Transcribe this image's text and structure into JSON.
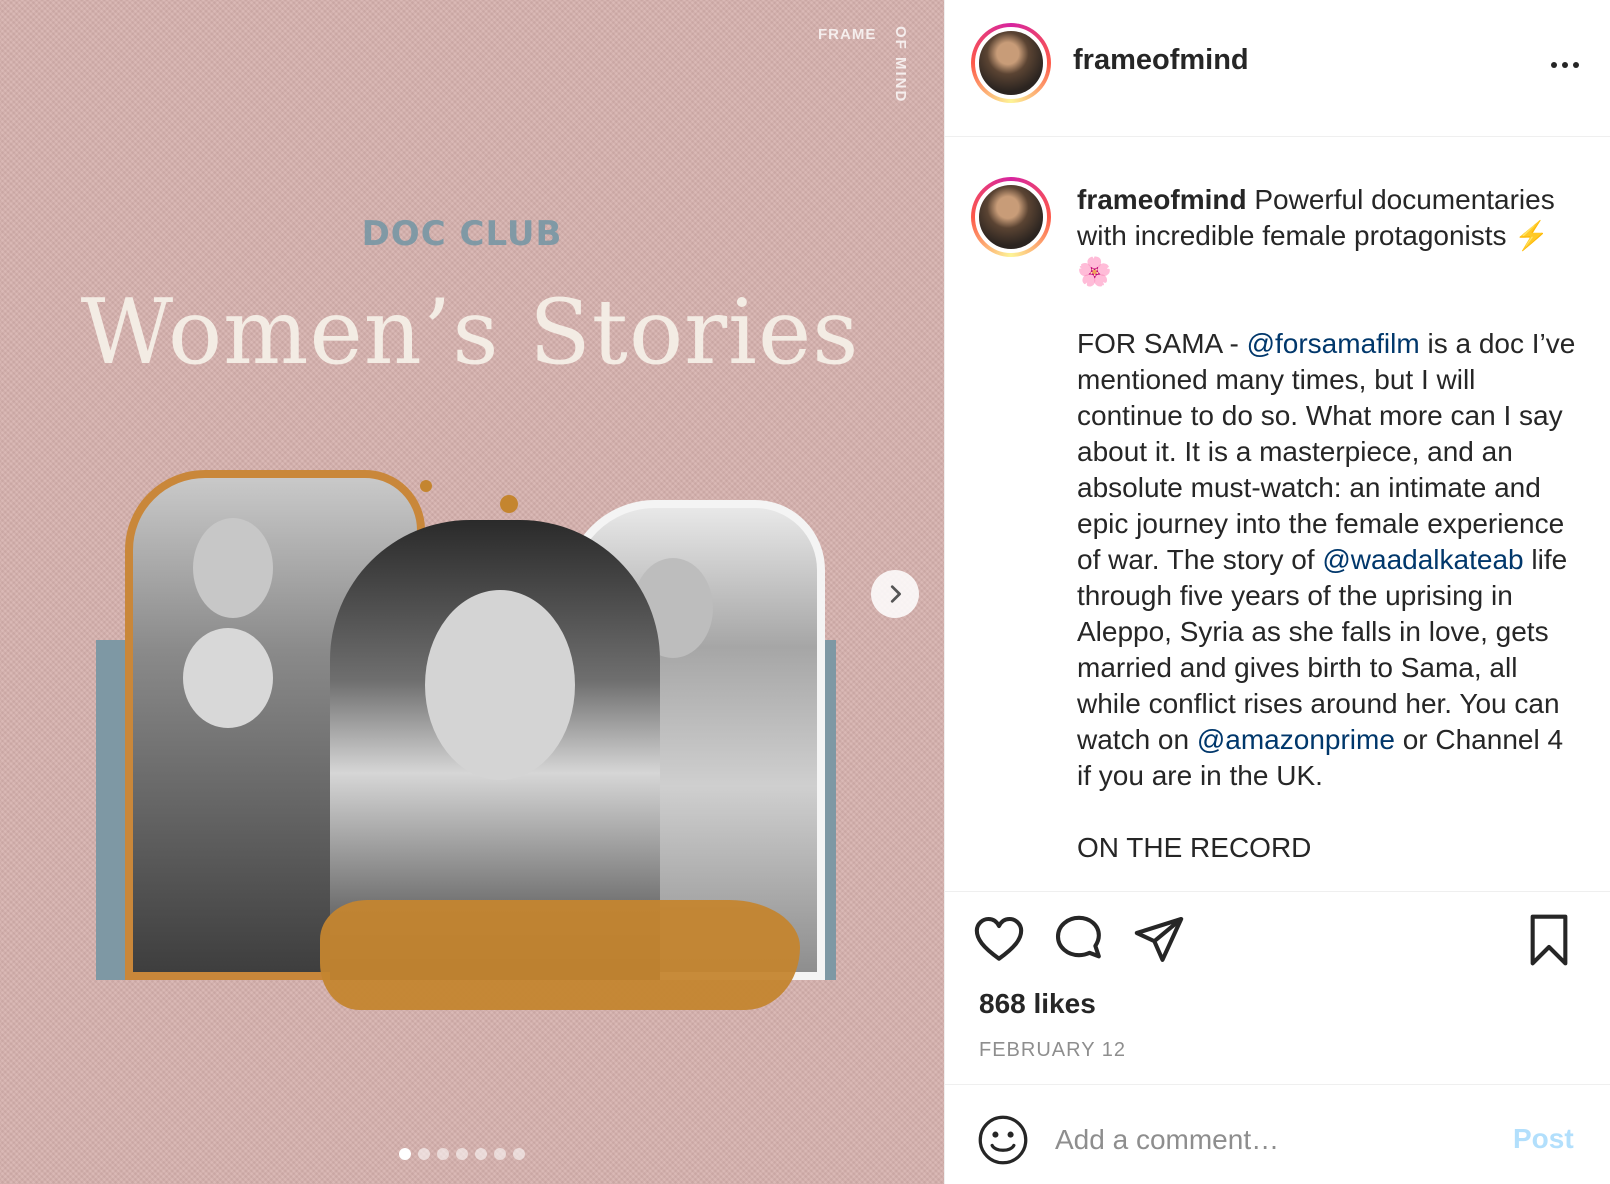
{
  "post": {
    "username": "frameofmind",
    "image": {
      "brand_line1": "FRAME",
      "brand_line2": "OF MIND",
      "kicker": "DOC CLUB",
      "title": "Women’s Stories",
      "colors": {
        "background": "#d6b1ad",
        "accent_orange": "#c4852f",
        "accent_blue": "#7e98a4"
      },
      "carousel_total": 7,
      "carousel_active": 1
    },
    "caption": {
      "username": "frameofmind",
      "p1": " Powerful documentaries with incredible female protagonists ⚡🌸",
      "p2_a": "FOR SAMA - ",
      "mention1": "@forsamafilm",
      "p2_b": " is a doc I’ve mentioned many times, but I will continue to do so. What more can I say about it. It is a masterpiece, and an absolute must-watch: an intimate and epic journey into the female experience of war. The story of ",
      "mention2": "@waadalkateab",
      "p2_c": " life through five years of the uprising in Aleppo, Syria as she falls in love, gets married and gives birth to Sama, all while conflict rises around her. You can watch on ",
      "mention3": "@amazonprime",
      "p2_d": " or Channel 4 if you are in the UK.",
      "p3": "ON THE RECORD"
    },
    "likes": "868 likes",
    "date": "FEBRUARY 12",
    "comment": {
      "placeholder": "Add a comment…",
      "post_label": "Post"
    },
    "icons": [
      "next-arrow-icon",
      "more-options-icon",
      "heart-icon",
      "comment-icon",
      "share-icon",
      "bookmark-icon",
      "emoji-icon"
    ]
  }
}
